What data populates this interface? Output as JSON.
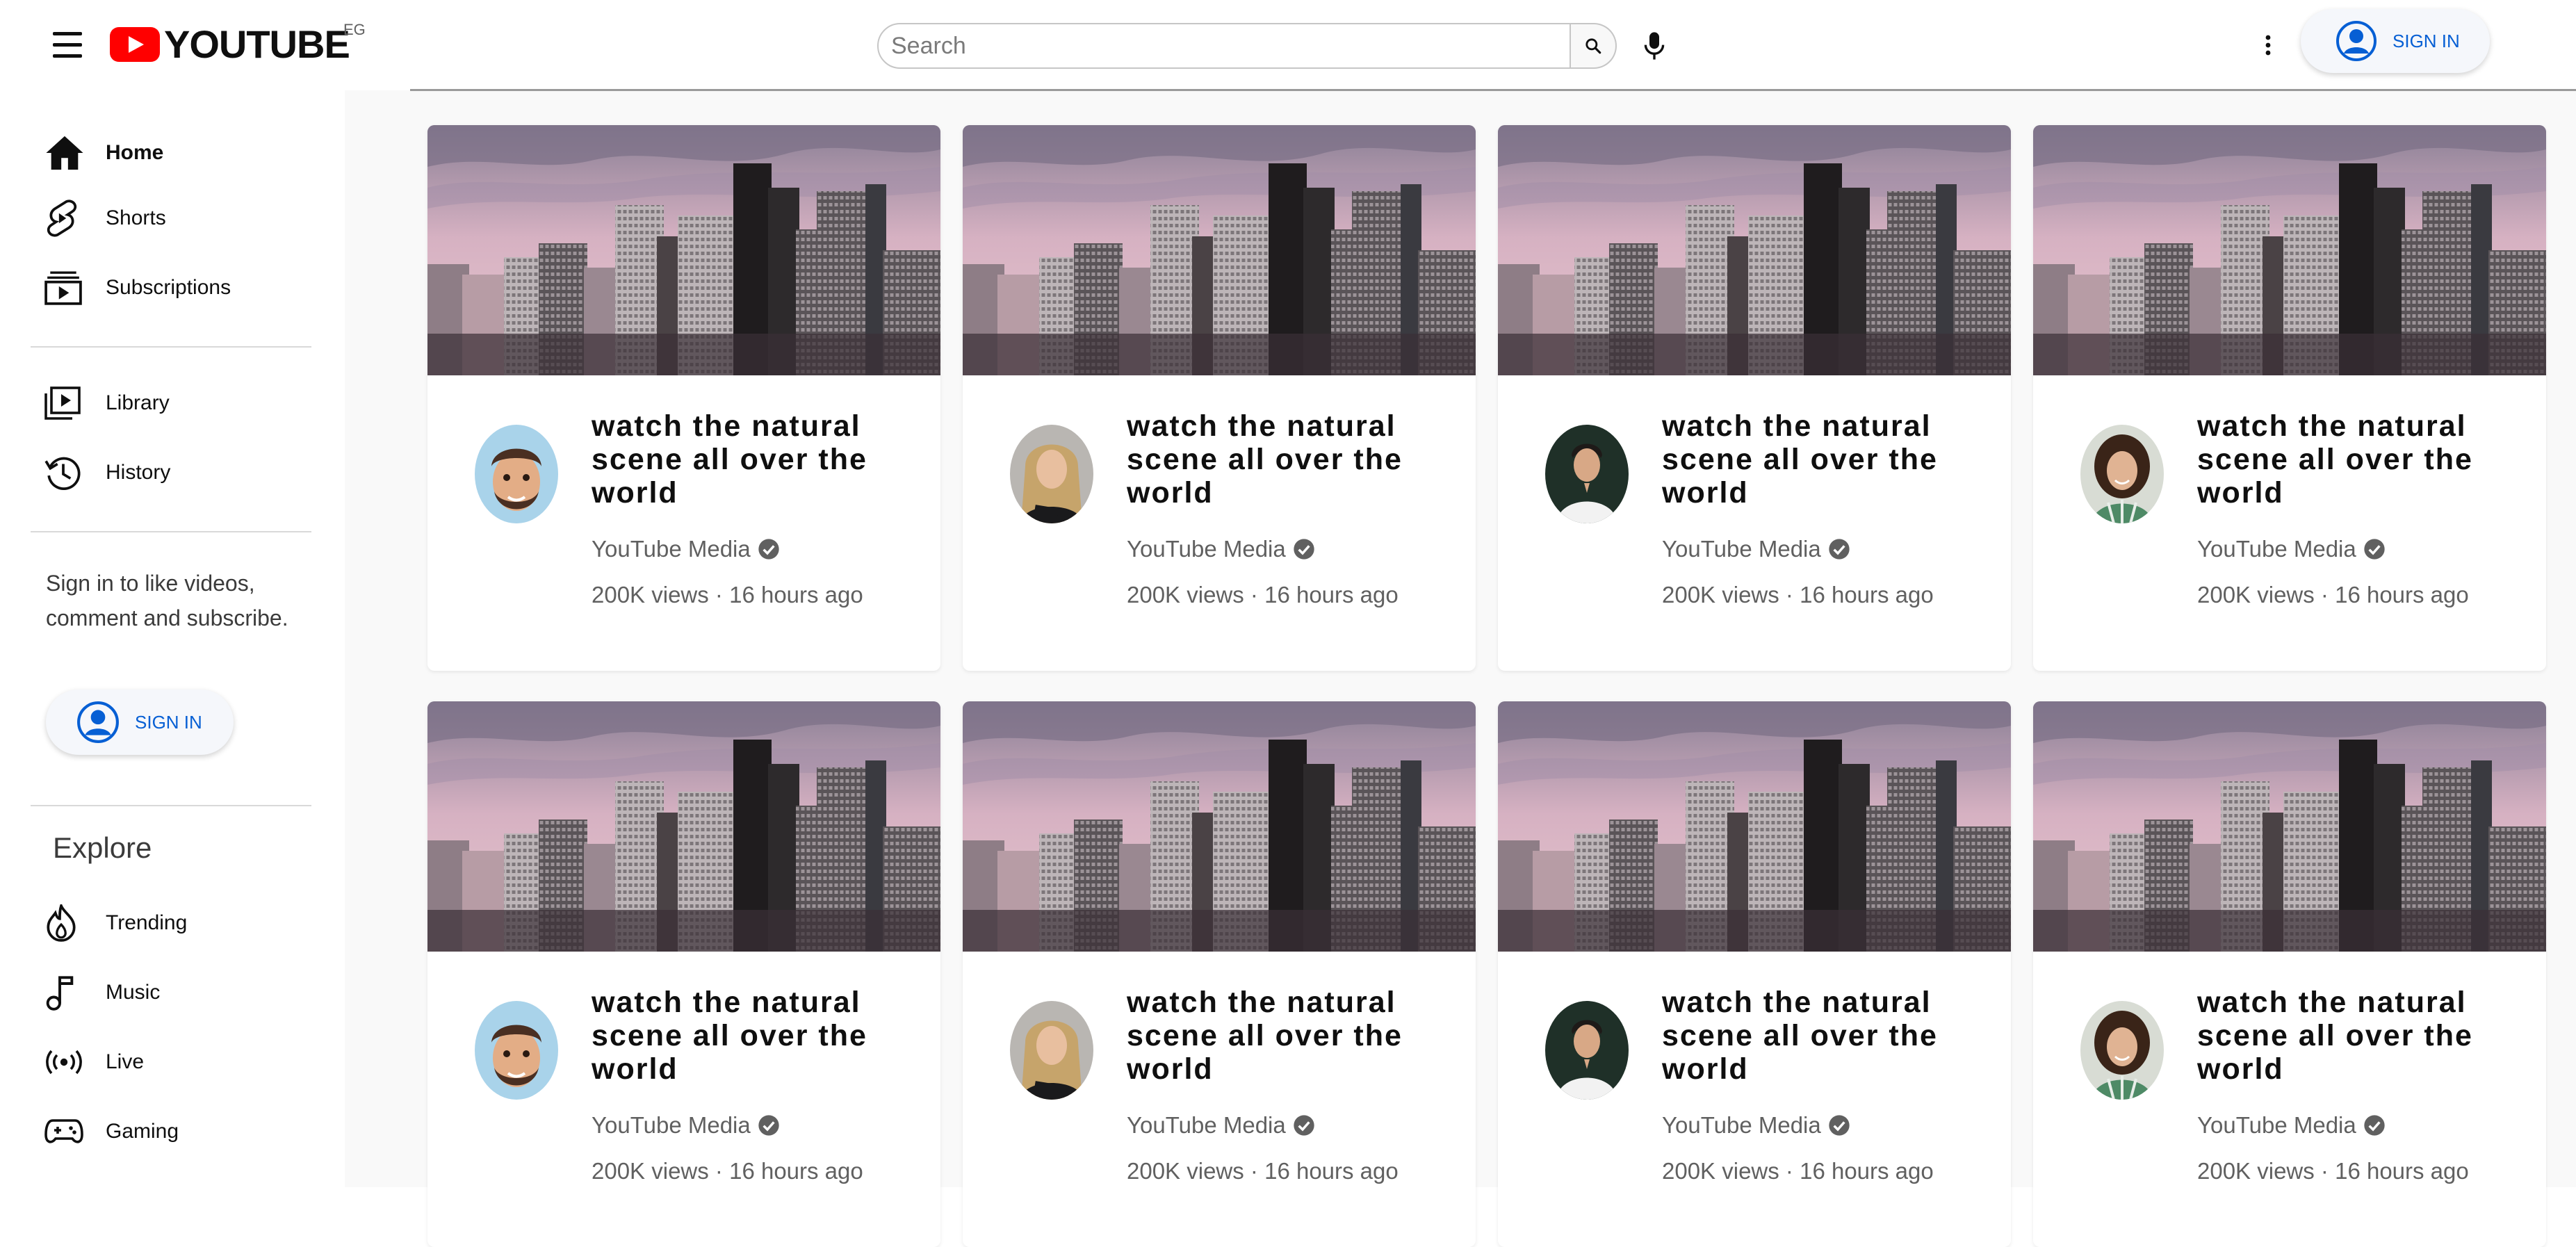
{
  "header": {
    "logo_text": "YOUTUBE",
    "country": "EG",
    "search_placeholder": "Search",
    "signin_label": "SIGN IN"
  },
  "sidebar": {
    "items": [
      {
        "label": "Home",
        "icon": "home-icon"
      },
      {
        "label": "Shorts",
        "icon": "shorts-icon"
      },
      {
        "label": "Subscriptions",
        "icon": "subscriptions-icon"
      },
      {
        "label": "Library",
        "icon": "library-icon"
      },
      {
        "label": "History",
        "icon": "history-icon"
      }
    ],
    "signin_prompt": "Sign in to like videos, comment and subscribe.",
    "signin_label": "SIGN IN",
    "explore_title": "Explore",
    "explore_items": [
      {
        "label": "Trending",
        "icon": "trending-icon"
      },
      {
        "label": "Music",
        "icon": "music-icon"
      },
      {
        "label": "Live",
        "icon": "live-icon"
      },
      {
        "label": "Gaming",
        "icon": "gaming-icon"
      }
    ]
  },
  "videos": [
    {
      "title": "watch the natural scene all over the world",
      "channel": "YouTube Media",
      "views": "200K views",
      "age": "16 hours ago",
      "avatar": "memoji-man"
    },
    {
      "title": "watch the natural scene all over the world",
      "channel": "YouTube Media",
      "views": "200K views",
      "age": "16 hours ago",
      "avatar": "blonde-woman"
    },
    {
      "title": "watch the natural scene all over the world",
      "channel": "YouTube Media",
      "views": "200K views",
      "age": "16 hours ago",
      "avatar": "man-white-shirt"
    },
    {
      "title": "watch the natural scene all over the world",
      "channel": "YouTube Media",
      "views": "200K views",
      "age": "16 hours ago",
      "avatar": "curly-woman"
    },
    {
      "title": "watch the natural scene all over the world",
      "channel": "YouTube Media",
      "views": "200K views",
      "age": "16 hours ago",
      "avatar": "memoji-man"
    },
    {
      "title": "watch the natural scene all over the world",
      "channel": "YouTube Media",
      "views": "200K views",
      "age": "16 hours ago",
      "avatar": "blonde-woman"
    },
    {
      "title": "watch the natural scene all over the world",
      "channel": "YouTube Media",
      "views": "200K views",
      "age": "16 hours ago",
      "avatar": "man-white-shirt"
    },
    {
      "title": "watch the natural scene all over the world",
      "channel": "YouTube Media",
      "views": "200K views",
      "age": "16 hours ago",
      "avatar": "curly-woman"
    }
  ],
  "colors": {
    "brand_red": "#ff0000",
    "link_blue": "#065fd4",
    "text_secondary": "#606060"
  }
}
